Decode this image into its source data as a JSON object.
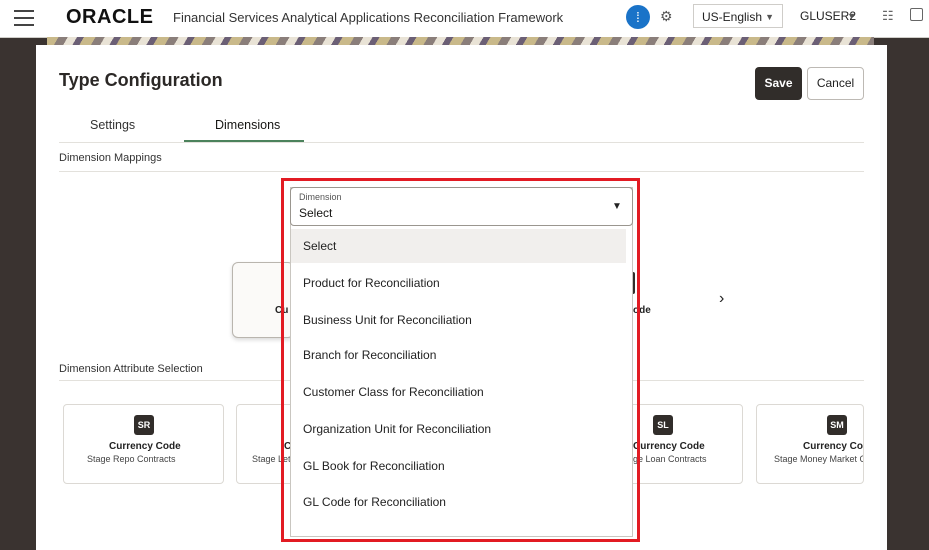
{
  "header": {
    "logo_text": "ORACLE",
    "app_title": "Financial Services Analytical Applications Reconciliation Framework",
    "language": "US-English",
    "user": "GLUSER2",
    "icons": [
      "hamburger-icon",
      "apps-grid-icon",
      "user-settings-icon",
      "hierarchy-icon",
      "window-icon"
    ]
  },
  "page": {
    "title": "Type Configuration",
    "save_label": "Save",
    "cancel_label": "Cancel"
  },
  "tabs": [
    {
      "label": "Settings",
      "active": false
    },
    {
      "label": "Dimensions",
      "active": true
    }
  ],
  "sections": {
    "mappings": "Dimension Mappings",
    "attributes": "Dimension Attribute Selection"
  },
  "mapping": {
    "card_fragment": "Cu",
    "right_fragment": "ode"
  },
  "attribute_cards": [
    {
      "badge": "SR",
      "name": "Currency Code",
      "sub": "Stage Repo Contracts"
    },
    {
      "badge": "",
      "name": "C",
      "sub": "Stage Let"
    },
    {
      "badge": "SL",
      "name": "Currency Code",
      "sub": "ge Loan Contracts"
    },
    {
      "badge": "SM",
      "name": "Currency Code",
      "sub": "Stage Money Market C"
    }
  ],
  "dimension_select": {
    "label": "Dimension",
    "value": "Select",
    "options": [
      "Select",
      "Product for Reconciliation",
      "Business Unit for Reconciliation",
      "Branch for Reconciliation",
      "Customer Class for Reconciliation",
      "Organization Unit for Reconciliation",
      "GL Book for Reconciliation",
      "GL Code for Reconciliation"
    ]
  },
  "colors": {
    "primary_button": "#312d2a",
    "tab_accent": "#4c825c",
    "highlight": "#e21b23",
    "apps_icon": "#1a73c8"
  }
}
